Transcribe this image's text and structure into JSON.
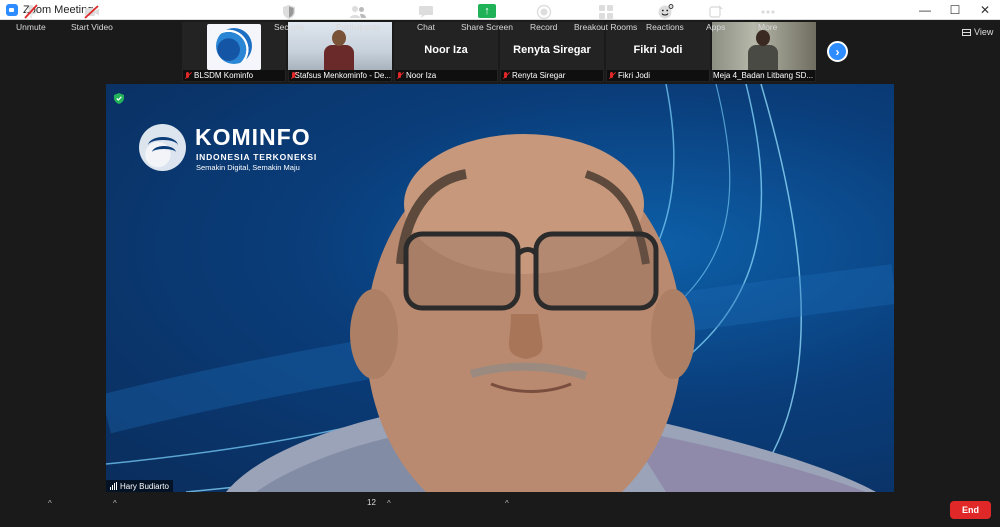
{
  "window": {
    "title": "Zoom Meeting",
    "controls": [
      "—",
      "☐",
      "✕"
    ]
  },
  "filmstrip": {
    "tiles": [
      {
        "name": "",
        "label": "BLSDM Kominfo",
        "muted": true,
        "kind": "logo"
      },
      {
        "name": "",
        "label": "Stafsus Menkominfo - De...",
        "muted": true,
        "kind": "photo"
      },
      {
        "name": "Noor Iza",
        "label": "Noor Iza",
        "muted": true,
        "kind": "name"
      },
      {
        "name": "Renyta Siregar",
        "label": "Renyta Siregar",
        "muted": true,
        "kind": "name"
      },
      {
        "name": "Fikri Jodi",
        "label": "Fikri Jodi",
        "muted": true,
        "kind": "name"
      },
      {
        "name": "",
        "label": "Meja 4_Badan Litbang SD...",
        "muted": false,
        "kind": "outdoor"
      }
    ],
    "next_icon": "›"
  },
  "view_label": "View",
  "speaker": {
    "name": "Hary Budiarto",
    "background": {
      "brand": "KOMINFO",
      "subtitle": "INDONESIA TERKONEKSI",
      "tagline": "Semakin Digital, Semakin Maju"
    }
  },
  "toolbar": {
    "unmute": "Unmute",
    "start_video": "Start Video",
    "security": "Security",
    "participants": "Participants",
    "participants_count": "12",
    "chat": "Chat",
    "share_screen": "Share Screen",
    "record": "Record",
    "breakout_rooms": "Breakout Rooms",
    "reactions": "Reactions",
    "apps": "Apps",
    "more": "More",
    "end": "End",
    "caret": "^"
  },
  "colors": {
    "accent": "#2d8cff",
    "share_green": "#1fb256",
    "end_red": "#e02828",
    "mute_red": "#e02828"
  }
}
